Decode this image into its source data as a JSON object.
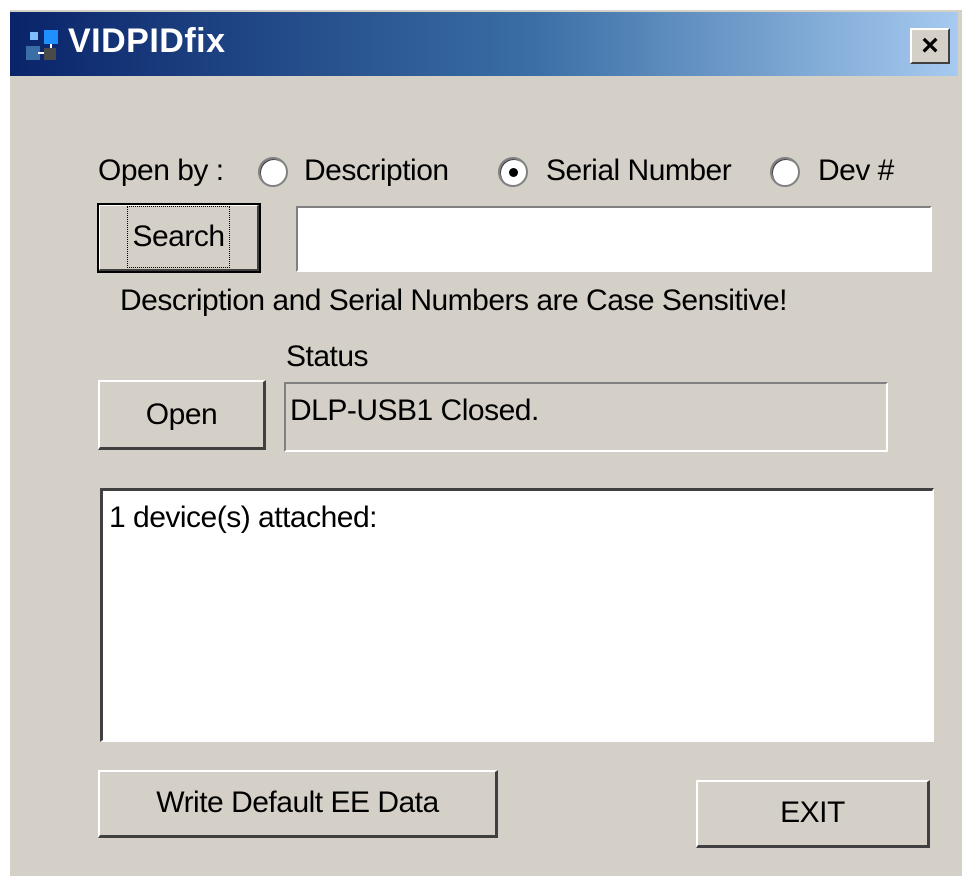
{
  "window": {
    "title": "VIDPIDfix",
    "close_glyph": "×",
    "icon": "usb-app-icon"
  },
  "open_by": {
    "label": "Open by :",
    "options": [
      {
        "label": "Description",
        "selected": false
      },
      {
        "label": "Serial Number",
        "selected": true
      },
      {
        "label": "Dev #",
        "selected": false
      }
    ]
  },
  "search": {
    "button_label": "Search",
    "input_value": ""
  },
  "notice": "Description and Serial Numbers are Case Sensitive!",
  "status": {
    "label": "Status",
    "open_button_label": "Open",
    "value": "DLP-USB1 Closed."
  },
  "device_list": {
    "lines": [
      "1 device(s) attached:"
    ]
  },
  "footer": {
    "write_button_label": "Write Default EE Data",
    "exit_button_label": "EXIT"
  },
  "colors": {
    "face": "#d4d0c8",
    "title_start": "#0a246a",
    "title_end": "#a6caf0"
  }
}
